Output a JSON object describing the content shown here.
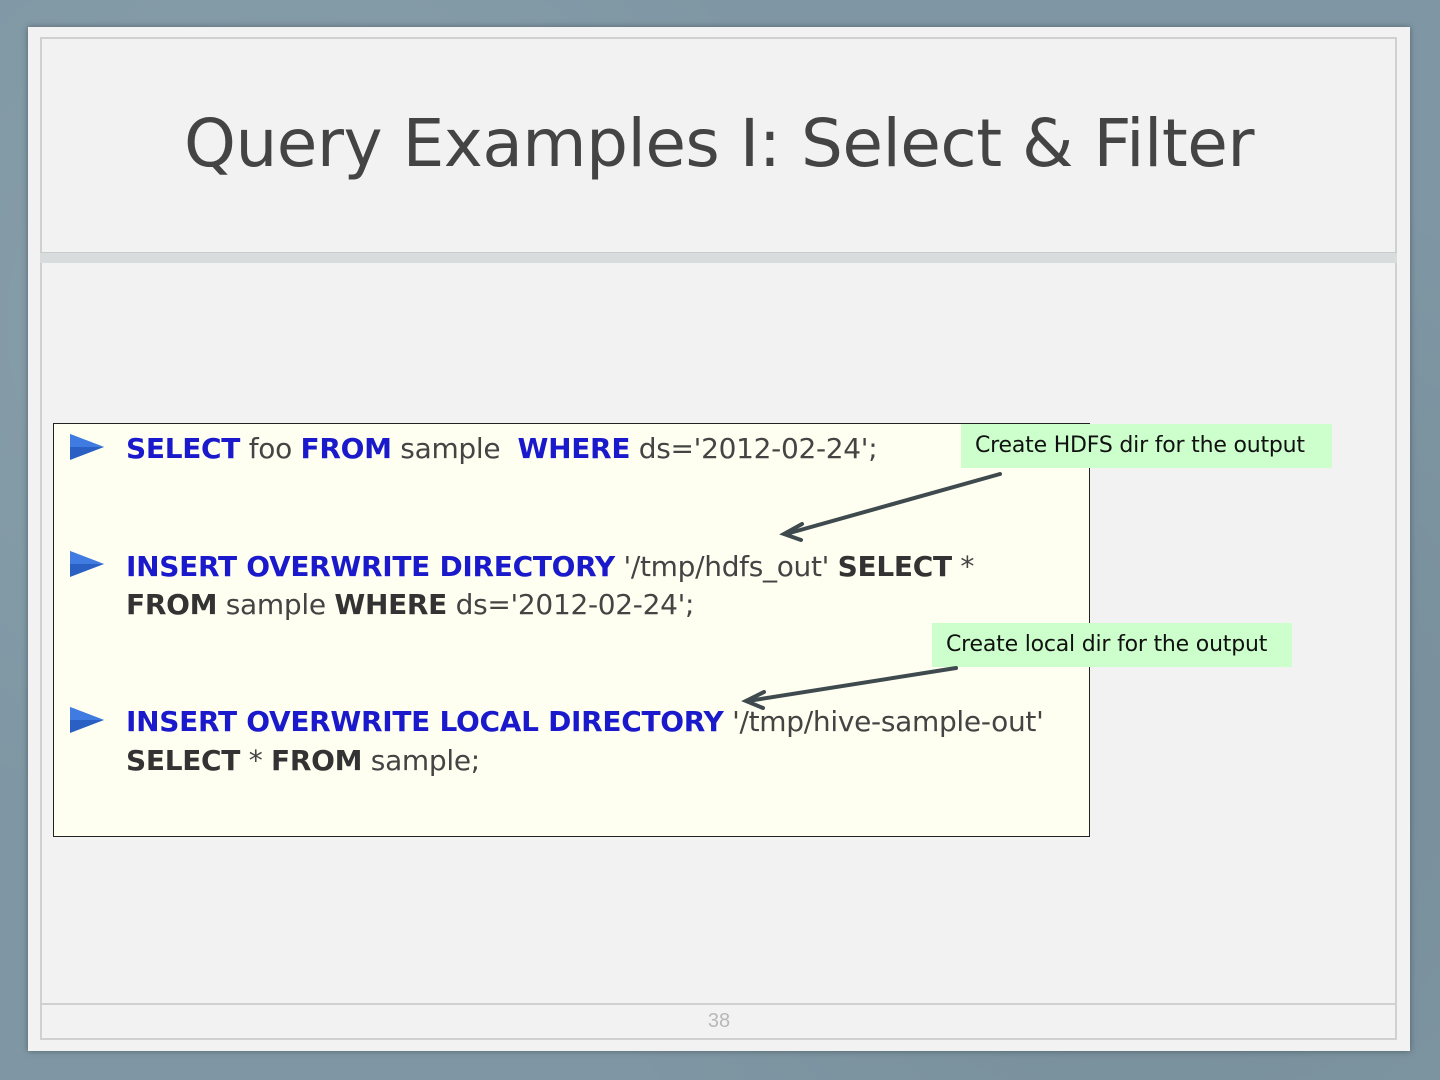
{
  "slide": {
    "title": "Query Examples I: Select & Filter",
    "page_number": "38"
  },
  "code": {
    "q1": {
      "t1": "SELECT",
      "t2": " foo ",
      "t3": "FROM",
      "t4": " sample  ",
      "t5": "WHERE",
      "t6": " ds='2012-02-24';"
    },
    "q2": {
      "l1a": "INSERT OVERWRITE DIRECTORY",
      "l1b": " '/tmp/hdfs_out' ",
      "l1c": "SELECT",
      "l1d": " *",
      "l2a": "FROM",
      "l2b": " sample ",
      "l2c": "WHERE",
      "l2d": " ds='2012-02-24';"
    },
    "q3": {
      "l1a": "INSERT OVERWRITE LOCAL DIRECTORY",
      "l1b": " '/tmp/hive-sample-out'",
      "l2a": "SELECT",
      "l2b": " * ",
      "l2c": "FROM",
      "l2d": " sample;"
    }
  },
  "callouts": {
    "hdfs": "Create HDFS dir for the output",
    "local": "Create local dir for the output"
  },
  "colors": {
    "keyword": "#1a1acc",
    "callout_bg": "#ccffcc",
    "code_bg": "#fefff0"
  },
  "icons": [
    "play-bullet-icon",
    "arrow-icon"
  ]
}
